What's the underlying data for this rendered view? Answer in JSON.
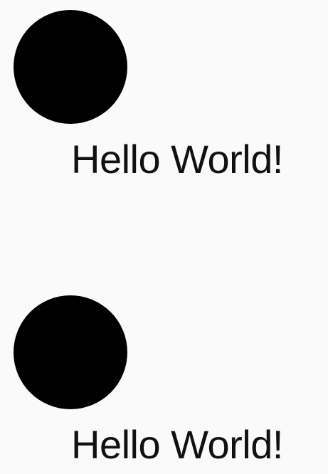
{
  "items": [
    {
      "text": "Hello World!"
    },
    {
      "text": "Hello World!"
    }
  ],
  "colors": {
    "background": "#fafafa",
    "dot": "#000000",
    "text": "#111111"
  }
}
